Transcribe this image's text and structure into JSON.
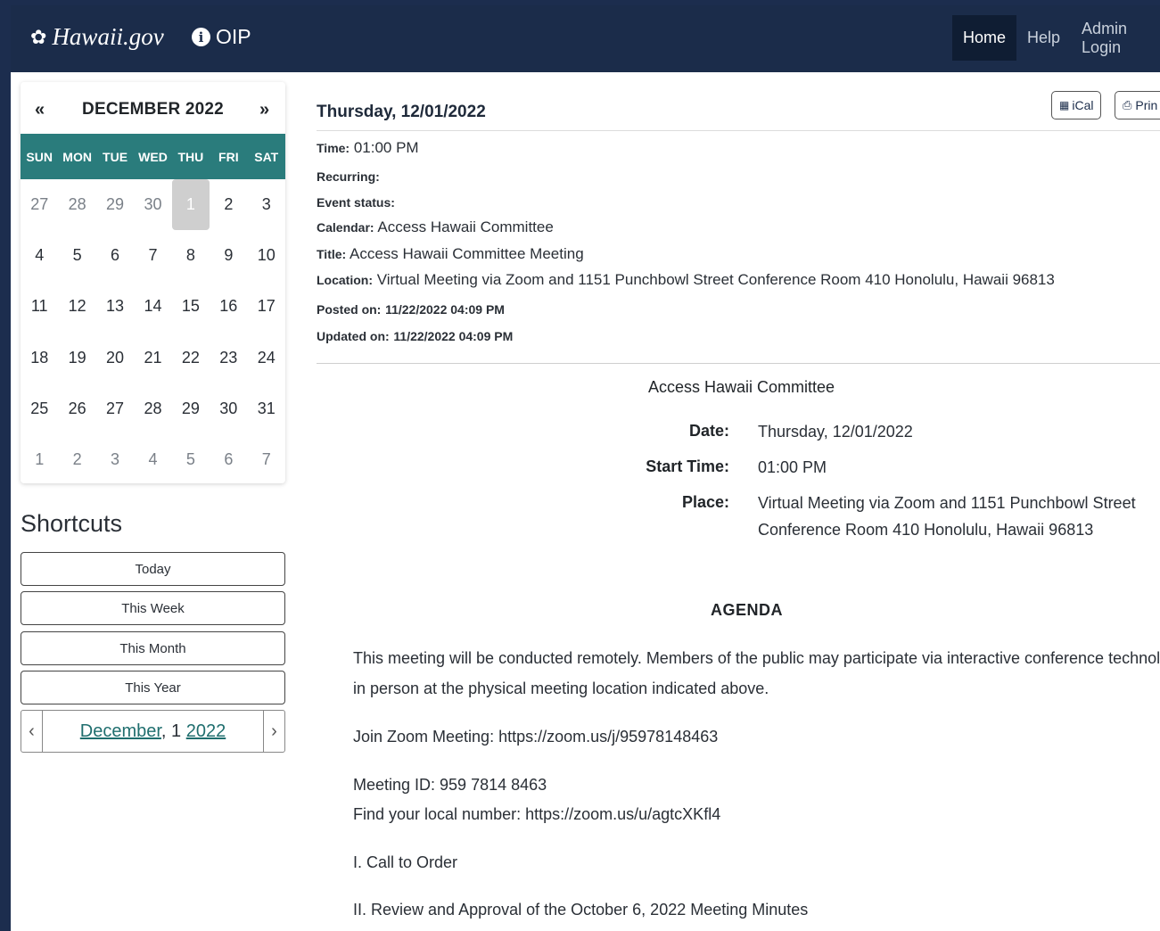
{
  "navbar": {
    "brand": "Hawaii.gov",
    "app_name": "OIP",
    "links": [
      "Home",
      "Help",
      "Admin Login"
    ],
    "active": "Home"
  },
  "calendar": {
    "prev": "«",
    "next": "»",
    "month_title": "DECEMBER 2022",
    "weekdays": [
      "SUN",
      "MON",
      "TUE",
      "WED",
      "THU",
      "FRI",
      "SAT"
    ],
    "weeks": [
      [
        "27",
        "28",
        "29",
        "30",
        "1",
        "2",
        "3"
      ],
      [
        "4",
        "5",
        "6",
        "7",
        "8",
        "9",
        "10"
      ],
      [
        "11",
        "12",
        "13",
        "14",
        "15",
        "16",
        "17"
      ],
      [
        "18",
        "19",
        "20",
        "21",
        "22",
        "23",
        "24"
      ],
      [
        "25",
        "26",
        "27",
        "28",
        "29",
        "30",
        "31"
      ],
      [
        "1",
        "2",
        "3",
        "4",
        "5",
        "6",
        "7"
      ]
    ],
    "selected_day": "1"
  },
  "shortcuts": {
    "title": "Shortcuts",
    "buttons": [
      "Today",
      "This Week",
      "This Month",
      "This Year"
    ],
    "date_nav": {
      "month": "December",
      "day": ", 1 ",
      "year": "2022",
      "prev": "‹",
      "next": "›"
    }
  },
  "event": {
    "date_heading": "Thursday, 12/01/2022",
    "ical": "iCal",
    "print": "Prin",
    "fields": {
      "time_label": "Time:",
      "time": "01:00 PM",
      "recurring_label": "Recurring:",
      "status_label": "Event status:",
      "calendar_label": "Calendar:",
      "calendar": "Access Hawaii Committee",
      "title_label": "Title:",
      "title": "Access Hawaii Committee Meeting",
      "location_label": "Location:",
      "location": "Virtual Meeting via Zoom and 1151 Punchbowl Street Conference Room 410 Honolulu, Hawaii 96813",
      "posted_label": "Posted on:",
      "posted": "11/22/2022 04:09 PM",
      "updated_label": "Updated on:",
      "updated": "11/22/2022 04:09 PM"
    },
    "details": {
      "committee": "Access Hawaii Committee",
      "date_label": "Date:",
      "date": "Thursday, 12/01/2022",
      "start_label": "Start Time:",
      "start": "01:00 PM",
      "place_label": "Place:",
      "place_line1": "Virtual Meeting via Zoom and 1151 Punchbowl Street",
      "place_line2": "Conference Room 410 Honolulu, Hawaii 96813"
    },
    "agenda": {
      "title": "AGENDA",
      "intro_line1": "This meeting will be conducted remotely. Members of the public may participate via interactive conference technology or",
      "intro_line2": "in person at the physical meeting location indicated above.",
      "join": "Join Zoom Meeting: https://zoom.us/j/95978148463",
      "meeting_id": "Meeting ID: 959 7814 8463",
      "local_number": "Find your local number: https://zoom.us/u/agtcXKfl4",
      "item1": "I.  Call to Order",
      "item2": "II.  Review and Approval of the October 6, 2022 Meeting Minutes"
    }
  }
}
